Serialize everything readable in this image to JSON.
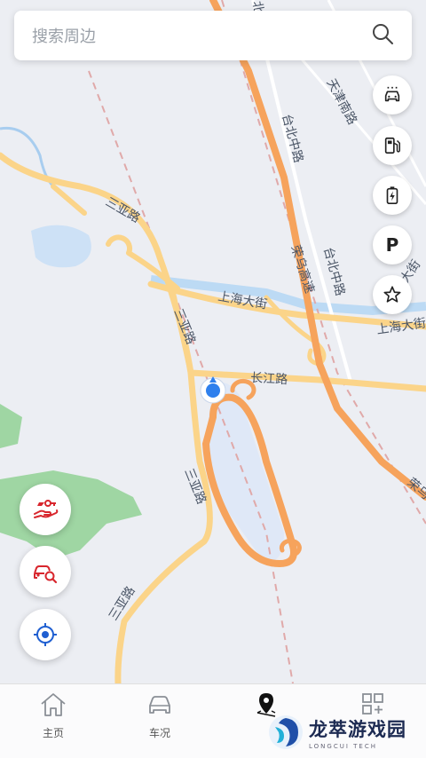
{
  "search": {
    "placeholder": "搜索周边"
  },
  "map": {
    "roads": {
      "sanya_road_1": "三亚路",
      "sanya_road_2": "三亚路",
      "sanya_road_3": "三亚路",
      "sanya_road_4": "三亚路",
      "shanghai_st_1": "上海大街",
      "shanghai_st_2": "上海大街",
      "changjiang_road": "长江路",
      "rongwu_expwy_1": "荣乌高速",
      "rongwu_expwy_2": "荣乌",
      "taibei_zhong_1": "台北中路",
      "taibei_zhong_2": "台北中路",
      "tianjin_south": "天津南路",
      "cut_top": "北中",
      "cut_right": "大街"
    },
    "colors": {
      "background": "#eceef3",
      "arterial": "#fbd489",
      "expressway": "#f6a35c",
      "water": "#cde1f6",
      "green": "#9fd6a3",
      "location": "#2f80ed"
    }
  },
  "side_buttons": [
    {
      "name": "car-wash",
      "icon": "car-wash-icon"
    },
    {
      "name": "fuel",
      "icon": "fuel-pump-icon"
    },
    {
      "name": "charging",
      "icon": "battery-charge-icon"
    },
    {
      "name": "parking",
      "label": "P"
    },
    {
      "name": "favorites",
      "icon": "star-icon"
    }
  ],
  "left_buttons": [
    {
      "name": "car-sharing",
      "icon": "car-key-hand-icon"
    },
    {
      "name": "find-car",
      "icon": "car-search-icon"
    },
    {
      "name": "locate",
      "icon": "locate-icon"
    }
  ],
  "tabs": [
    {
      "label": "主页",
      "icon": "home-icon"
    },
    {
      "label": "车况",
      "icon": "car-icon"
    },
    {
      "label": "",
      "icon": "map-pin-icon",
      "active": true
    },
    {
      "label": "",
      "icon": "grid-plus-icon"
    }
  ],
  "watermark": {
    "title": "龙萃游戏园",
    "subtitle": "LONGCUI TECH"
  }
}
